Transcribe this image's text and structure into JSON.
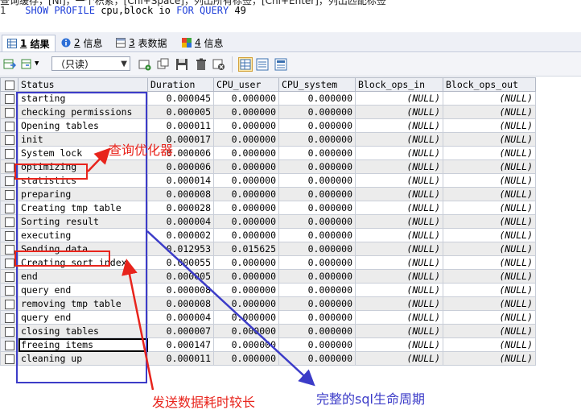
{
  "query": {
    "top_fragment": "查询缓存，[Nl]，一个积累，[Chl+Space]，列出所有标签，[Chl+Enter]，列出匹配标签",
    "line_number": "1",
    "keyword_show": "SHOW",
    "keyword_profile": "PROFILE",
    "text_1": "cpu,block io",
    "keyword_for": "FOR",
    "keyword_query": "QUERY",
    "query_id": "49"
  },
  "tabs": [
    {
      "num": "1",
      "label": "结果",
      "icon": "grid-icon"
    },
    {
      "num": "2",
      "label": "信息",
      "icon": "info-icon"
    },
    {
      "num": "3",
      "label": "表数据",
      "icon": "table-icon"
    },
    {
      "num": "4",
      "label": "信息",
      "icon": "colors-icon"
    }
  ],
  "toolbar": {
    "mode_select": "（只读）"
  },
  "columns": [
    "Status",
    "Duration",
    "CPU_user",
    "CPU_system",
    "Block_ops_in",
    "Block_ops_out"
  ],
  "rows": [
    [
      "starting",
      "0.000045",
      "0.000000",
      "0.000000",
      "(NULL)",
      "(NULL)"
    ],
    [
      "checking permissions",
      "0.000005",
      "0.000000",
      "0.000000",
      "(NULL)",
      "(NULL)"
    ],
    [
      "Opening tables",
      "0.000011",
      "0.000000",
      "0.000000",
      "(NULL)",
      "(NULL)"
    ],
    [
      "init",
      "0.000017",
      "0.000000",
      "0.000000",
      "(NULL)",
      "(NULL)"
    ],
    [
      "System lock",
      "0.000006",
      "0.000000",
      "0.000000",
      "(NULL)",
      "(NULL)"
    ],
    [
      "optimizing",
      "0.000006",
      "0.000000",
      "0.000000",
      "(NULL)",
      "(NULL)"
    ],
    [
      "statistics",
      "0.000014",
      "0.000000",
      "0.000000",
      "(NULL)",
      "(NULL)"
    ],
    [
      "preparing",
      "0.000008",
      "0.000000",
      "0.000000",
      "(NULL)",
      "(NULL)"
    ],
    [
      "Creating tmp table",
      "0.000028",
      "0.000000",
      "0.000000",
      "(NULL)",
      "(NULL)"
    ],
    [
      "Sorting result",
      "0.000004",
      "0.000000",
      "0.000000",
      "(NULL)",
      "(NULL)"
    ],
    [
      "executing",
      "0.000002",
      "0.000000",
      "0.000000",
      "(NULL)",
      "(NULL)"
    ],
    [
      "Sending data",
      "0.012953",
      "0.015625",
      "0.000000",
      "(NULL)",
      "(NULL)"
    ],
    [
      "Creating sort index",
      "0.000055",
      "0.000000",
      "0.000000",
      "(NULL)",
      "(NULL)"
    ],
    [
      "end",
      "0.000005",
      "0.000000",
      "0.000000",
      "(NULL)",
      "(NULL)"
    ],
    [
      "query end",
      "0.000008",
      "0.000000",
      "0.000000",
      "(NULL)",
      "(NULL)"
    ],
    [
      "removing tmp table",
      "0.000008",
      "0.000000",
      "0.000000",
      "(NULL)",
      "(NULL)"
    ],
    [
      "query end",
      "0.000004",
      "0.000000",
      "0.000000",
      "(NULL)",
      "(NULL)"
    ],
    [
      "closing tables",
      "0.000007",
      "0.000000",
      "0.000000",
      "(NULL)",
      "(NULL)"
    ],
    [
      "freeing items",
      "0.000147",
      "0.000000",
      "0.000000",
      "(NULL)",
      "(NULL)"
    ],
    [
      "cleaning up",
      "0.000011",
      "0.000000",
      "0.000000",
      "(NULL)",
      "(NULL)"
    ]
  ],
  "selected_row": 18,
  "annotations": {
    "optimizer_label": "查询优化器",
    "sending_label": "发送数据耗时较长",
    "lifecycle_label": "完整的sql生命周期",
    "red": "#e8241c",
    "blue": "#3c3cc8"
  }
}
